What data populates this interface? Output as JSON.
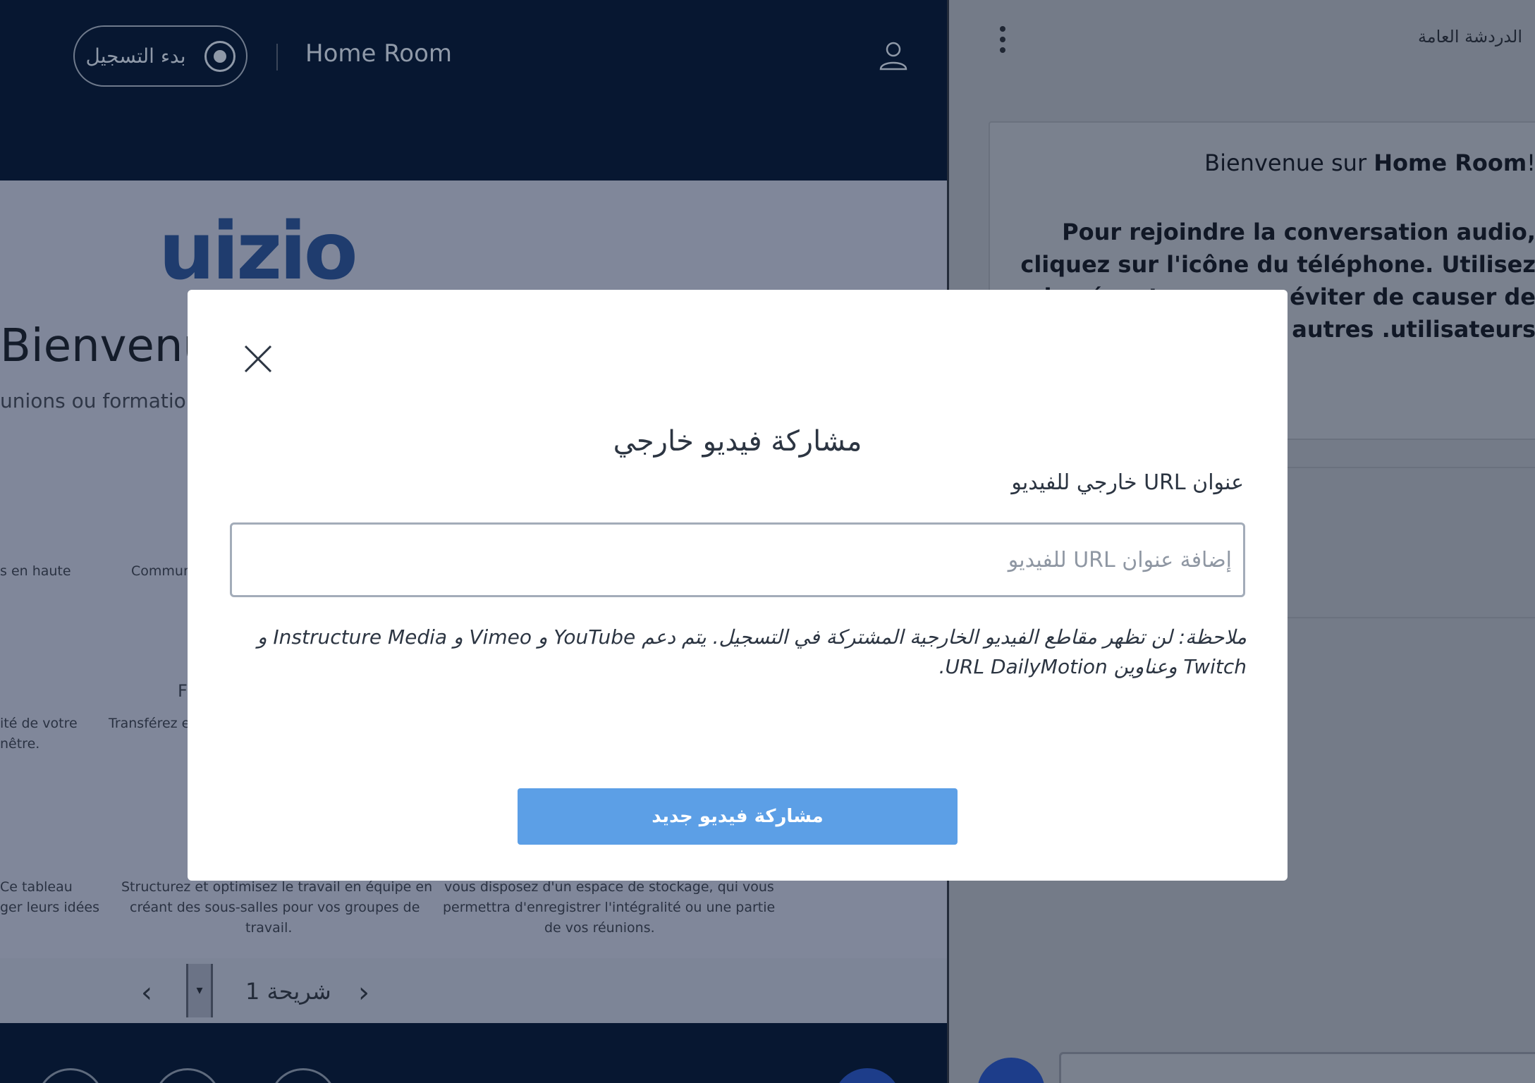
{
  "topbar": {
    "record_label": "بدء التسجيل",
    "room_title": "Home Room"
  },
  "slide": {
    "logo": "uizio",
    "welcome": "Bienvenue",
    "subtitle": "unions ou formations",
    "features": [
      "s en haute",
      "Commun",
      "F",
      "ité de votre",
      "nêtre.",
      "Transférez et",
      "Ce tableau",
      "ger leurs idées",
      "Structurez et optimisez le travail en équipe en",
      "créant des sous-salles pour vos groupes de",
      "travail.",
      "vous disposez d'un espace de stockage, qui vous",
      "permettra d'enregistrer l'intégralité ou une partie",
      "de vos réunions."
    ]
  },
  "slide_nav": {
    "prev": "‹",
    "dropdown": "▾",
    "label": "شريحة 1",
    "next": "›"
  },
  "chat": {
    "title": "الدردشة العامة",
    "greeting_prefix": "!Bienvenue sur ",
    "greeting_room": "Home Room",
    "body": "Pour rejoindre la conversation audio, cliquez sur l'icône du téléphone. Utilisez des écouteurs pour éviter de causer de l'écho aux autres .utilisateurs"
  },
  "modal": {
    "title": "مشاركة فيديو خارجي",
    "url_label": "عنوان URL خارجي للفيديو",
    "url_placeholder": "إضافة عنوان URL للفيديو",
    "url_value": "",
    "note": "ملاحظة: لن تظهر مقاطع الفيديو الخارجية المشتركة في التسجيل. يتم دعم YouTube و Vimeo و Instructure Media و Twitch وعناوين URL DailyMotion.",
    "share_button": "مشاركة فيديو جديد"
  },
  "icons": {
    "close": "close-icon",
    "user": "user-icon",
    "record": "record-icon",
    "menu": "kebab-menu-icon"
  },
  "colors": {
    "modal_bg": "#ffffff",
    "primary_button": "#5c9fe6",
    "topbar": "#071731",
    "overlay_text": "#2c3542"
  }
}
